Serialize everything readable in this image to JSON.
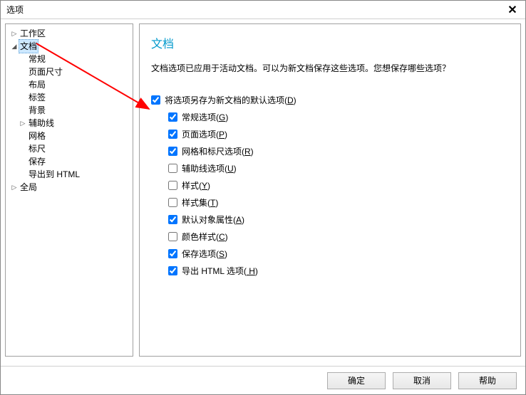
{
  "titlebar": {
    "title": "选项"
  },
  "sidebar": {
    "items": [
      {
        "label": "工作区",
        "expandable": true,
        "expanded": false,
        "level": 0
      },
      {
        "label": "文档",
        "expandable": true,
        "expanded": true,
        "level": 0,
        "selected": true
      },
      {
        "label": "常规",
        "level": 1
      },
      {
        "label": "页面尺寸",
        "level": 1
      },
      {
        "label": "布局",
        "level": 1
      },
      {
        "label": "标签",
        "level": 1
      },
      {
        "label": "背景",
        "level": 1
      },
      {
        "label": "辅助线",
        "expandable": true,
        "expanded": false,
        "level": 1
      },
      {
        "label": "网格",
        "level": 1
      },
      {
        "label": "标尺",
        "level": 1
      },
      {
        "label": "保存",
        "level": 1
      },
      {
        "label": "导出到 HTML",
        "level": 1
      },
      {
        "label": "全局",
        "expandable": true,
        "expanded": false,
        "level": 0
      }
    ]
  },
  "main": {
    "heading": "文档",
    "description": "文档选项已应用于活动文档。可以为新文档保存这些选项。您想保存哪些选项？",
    "parent_checkbox": {
      "label": "将选项另存为新文档的默认选项(",
      "accel": "D",
      "suffix": ")",
      "checked": true
    },
    "options": [
      {
        "label": "常规选项(",
        "accel": "G",
        "suffix": ")",
        "checked": true
      },
      {
        "label": "页面选项(",
        "accel": "P",
        "suffix": ")",
        "checked": true
      },
      {
        "label": "网格和标尺选项(",
        "accel": "R",
        "suffix": ")",
        "checked": true
      },
      {
        "label": "辅助线选项(",
        "accel": "U",
        "suffix": ")",
        "checked": false
      },
      {
        "label": "样式(",
        "accel": "Y",
        "suffix": ")",
        "checked": false
      },
      {
        "label": "样式集(",
        "accel": "T",
        "suffix": ")",
        "checked": false
      },
      {
        "label": "默认对象属性(",
        "accel": "A",
        "suffix": ")",
        "checked": true
      },
      {
        "label": "颜色样式(",
        "accel": "C",
        "suffix": ")",
        "checked": false
      },
      {
        "label": "保存选项(",
        "accel": "S",
        "suffix": ")",
        "checked": true
      },
      {
        "label": "导出 HTML 选项(",
        "accel": " H",
        "suffix": ")",
        "checked": true
      }
    ]
  },
  "footer": {
    "ok": "确定",
    "cancel": "取消",
    "help": "帮助"
  }
}
